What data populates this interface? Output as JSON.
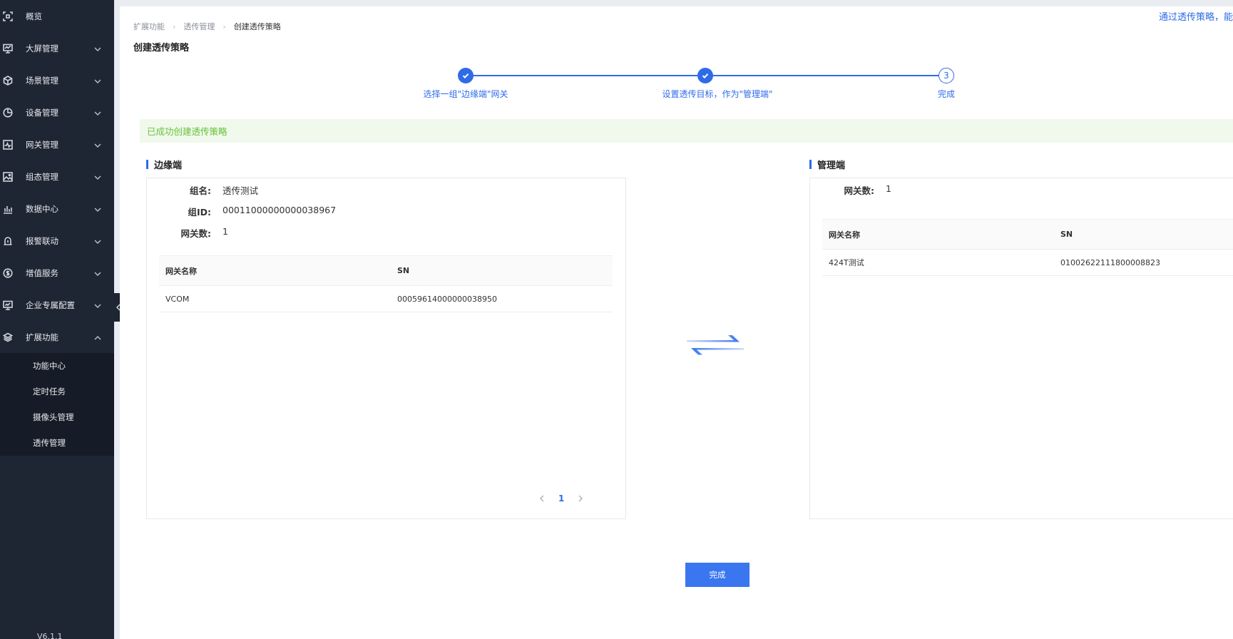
{
  "sidebar": {
    "items": [
      {
        "label": "概览",
        "icon": "overview-icon",
        "has_children": false
      },
      {
        "label": "大屏管理",
        "icon": "screen-icon",
        "has_children": true
      },
      {
        "label": "场景管理",
        "icon": "cube-icon",
        "has_children": true
      },
      {
        "label": "设备管理",
        "icon": "pie-icon",
        "has_children": true
      },
      {
        "label": "网关管理",
        "icon": "pulse-icon",
        "has_children": true
      },
      {
        "label": "组态管理",
        "icon": "image-icon",
        "has_children": true
      },
      {
        "label": "数据中心",
        "icon": "bar-chart-icon",
        "has_children": true
      },
      {
        "label": "报警联动",
        "icon": "alert-icon",
        "has_children": true
      },
      {
        "label": "增值服务",
        "icon": "coin-icon",
        "has_children": true
      },
      {
        "label": "企业专属配置",
        "icon": "monitor-icon",
        "has_children": true
      },
      {
        "label": "扩展功能",
        "icon": "layers-icon",
        "has_children": true,
        "expanded": true
      }
    ],
    "submenu": [
      "功能中心",
      "定时任务",
      "摄像头管理",
      "透传管理"
    ],
    "version": "V6.1.1"
  },
  "header": {
    "top_link": "通过透传策略，能",
    "breadcrumb": [
      "扩展功能",
      "透传管理",
      "创建透传策略"
    ],
    "page_title": "创建透传策略"
  },
  "steps": [
    {
      "label": "选择一组\"边缘端\"网关",
      "status": "done"
    },
    {
      "label": "设置透传目标，作为\"管理端\"",
      "status": "done"
    },
    {
      "label": "完成",
      "status": "current",
      "number": "3"
    }
  ],
  "alert": {
    "text": "已成功创建透传策略"
  },
  "edge": {
    "title": "边缘端",
    "fields": [
      {
        "key": "组名:",
        "value": "透传测试"
      },
      {
        "key": "组ID:",
        "value": "00011000000000038967"
      },
      {
        "key": "网关数:",
        "value": "1"
      }
    ],
    "columns": [
      "网关名称",
      "SN"
    ],
    "rows": [
      [
        "VCOM",
        "00059614000000038950"
      ]
    ],
    "page": "1"
  },
  "manager": {
    "title": "管理端",
    "fields": [
      {
        "key": "网关数:",
        "value": "1"
      }
    ],
    "columns": [
      "网关名称",
      "SN"
    ],
    "rows": [
      [
        "424T测试",
        "01002622111800008823"
      ]
    ]
  },
  "finish_label": "完成",
  "colors": {
    "accent": "#2f6be9",
    "success": "#67c23a",
    "sidebar": "#1f2633"
  }
}
